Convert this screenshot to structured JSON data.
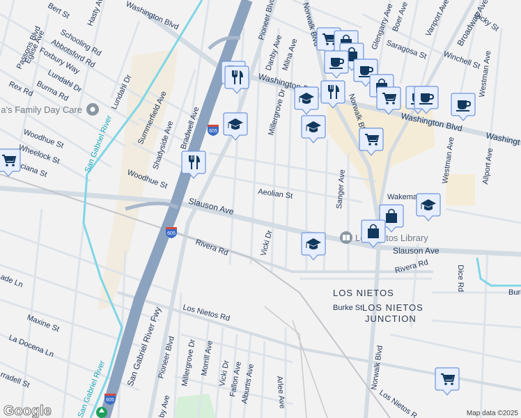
{
  "map": {
    "attribution": "Map data ©2025",
    "logo": "Google",
    "colors": {
      "background": "#f3f2f3",
      "freeway": "#8ca3bf",
      "major_road": "#d5dce3",
      "minor_road": "#dfe4ea",
      "river": "#7fd6e6",
      "commercial": "#f5ecd7",
      "park": "#d6efd9",
      "marker_fill": "#e6eeff",
      "marker_border": "#6f95d8",
      "icon": "#12385e"
    },
    "places": {
      "los_nietos": "LOS NIETOS",
      "junction_1": "LOS NIETOS",
      "junction_2": "JUNCTION"
    },
    "pois": {
      "day_care": "a's Family Day Care",
      "library": "Los Nietos Library"
    },
    "shields": {
      "i605": "605"
    },
    "streets": {
      "passons": "Passons Blvd",
      "eglise": "Eglise Ave",
      "bert": "Bert St",
      "hasty": "Hasty Ave",
      "washington_top": "Washington Blvd",
      "schooling": "Schooling Rd",
      "abbotsford": "Abbotsford Rd",
      "foxbury": "Foxbury Way",
      "lundahl_1": "Lundahl Dr",
      "rex": "Rex Rd",
      "burma": "Burma Rd",
      "lundahl_2": "Lundahl Dr",
      "woodhue_1": "Woodhue St",
      "wheelock": "Wheelock St",
      "poinciana": "Poinciana St",
      "river": "San Gabriel River",
      "summerfield": "Summerfield Ave",
      "shadyside": "Shadyside Ave",
      "bradwell": "Bradwell Ave",
      "woodhue_2": "Woodhue St",
      "slauson_1": "Slauson Ave",
      "pioneer_1": "Pioneer Blvd",
      "danby": "Danby Ave",
      "milna": "Milna Ave",
      "norwalk_1": "Norwalk Blvd",
      "washington_1": "Washington Blvd",
      "millergrove_1": "Millergrove Dr",
      "glengarry": "Glengarry Ave",
      "boer": "Boer Ave",
      "vanport": "Vanport Ave",
      "broadway": "Broadway Ave",
      "dicky": "Dicky St",
      "saragosa": "Saragosa St",
      "winchell": "Winchell St",
      "westman_1": "Westman Ave",
      "washington_2": "Washington Blvd",
      "washington_3": "Washingt",
      "westman_2": "Westman Ave",
      "allport": "Allport Ave",
      "aeolian": "Aeolian St",
      "sanger": "Sanger Ave",
      "wakeman": "Wakema",
      "norwalk_2": "Norwalk Blvd",
      "vicki_1": "Vicki Dr",
      "rivera_1": "Rivera Rd",
      "rivera_2": "Rivera Rd",
      "slauson_2": "Slauson Ave",
      "dice": "Dice Rd",
      "burke": "Burke St",
      "burl": "Burl",
      "los_nietos_rd": "Los Nietos Rd",
      "fwy": "San Gabriel River Fwy",
      "pioneer_2": "Pioneer Blvd",
      "maxine": "Maxine St",
      "la_docena": "La Docena Ln",
      "cascade": "ade Ln",
      "ferradell": "rradell St",
      "millergrove_2": "Millergrove Dr",
      "morrill": "Morrill Ave",
      "vicki_2": "Vicki Dr",
      "fallon": "Fallon Ave",
      "alburtis": "Alburtis Ave",
      "arlee": "Arlee Ave",
      "norwalk_3": "Norwalk Blvd",
      "los_nietos_rd_2": "Los Nietos R",
      "river_2": "San Gabriel River",
      "ruby": "by Ave"
    },
    "markers": [
      "shopping-cart",
      "dining",
      "dining",
      "school",
      "dining",
      "shopping-cart",
      "shopping-bag",
      "shopping-bag",
      "coffee",
      "coffee",
      "shopping-bag",
      "school",
      "dining",
      "coffee",
      "shopping-cart",
      "school",
      "shopping-cart",
      "coffee",
      "coffee",
      "school",
      "shopping-bag",
      "shopping-bag",
      "school",
      "shopping-cart"
    ]
  }
}
